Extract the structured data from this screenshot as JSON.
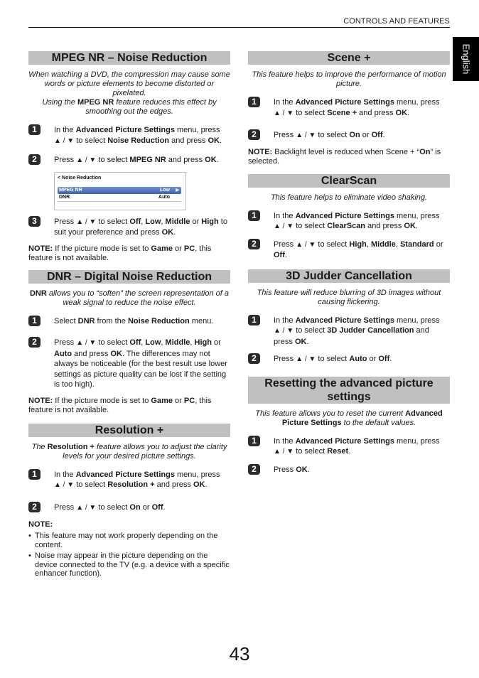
{
  "header": {
    "section": "CONTROLS AND FEATURES",
    "language_tab": "English"
  },
  "page_number": "43",
  "colors": {
    "section_bar": "#c0c0c0",
    "step_badge": "#2b2b2b",
    "menu_highlight": "#4a6db5",
    "language_tab": "#000000"
  },
  "sections": {
    "mpeg": {
      "title": "MPEG NR – Noise Reduction",
      "intro1": "When watching a DVD, the compression may cause some words or picture elements to become distorted or pixelated.",
      "intro2_a": "Using the ",
      "intro2_b": "MPEG NR",
      "intro2_c": " feature reduces this effect by smoothing out the edges.",
      "step1": {
        "num": "1",
        "a": "In the ",
        "b": "Advanced Picture Settings",
        "c": " menu, press ",
        "arrows": "▲ / ▼",
        "d": " to select ",
        "e": "Noise Reduction",
        "f": " and press ",
        "g": "OK",
        "h": "."
      },
      "step2": {
        "num": "2",
        "a": "Press ",
        "arrows": "▲ / ▼",
        "b": " to select ",
        "c": "MPEG NR",
        "d": " and press ",
        "e": "OK",
        "f": "."
      },
      "menu": {
        "title": "< Noise Reduction",
        "rows": [
          {
            "label": "MPEG NR",
            "value": "Low",
            "selected": true,
            "arrow": "▶"
          },
          {
            "label": "DNR",
            "value": "Auto",
            "selected": false
          }
        ]
      },
      "step3": {
        "num": "3",
        "a": "Press ",
        "arrows": "▲ / ▼",
        "b": " to select ",
        "c": "Off",
        "d": ", ",
        "e": "Low",
        "f": ", ",
        "g": "Middle",
        "h": " or ",
        "i": "High",
        "j": " to suit your preference and press ",
        "k": "OK",
        "l": "."
      },
      "note": {
        "label": "NOTE:",
        "a": " If the picture mode is set to ",
        "b": "Game",
        "c": " or ",
        "d": "PC",
        "e": ", this feature is not available."
      }
    },
    "dnr": {
      "title": "DNR – Digital Noise Reduction",
      "intro_a": "DNR",
      "intro_b": " allows you to “soften” the screen representation of a weak signal to reduce the noise effect.",
      "step1": {
        "num": "1",
        "a": "Select ",
        "b": "DNR",
        "c": " from the ",
        "d": "Noise Reduction",
        "e": " menu."
      },
      "step2": {
        "num": "2",
        "a": "Press ",
        "arrows": "▲ / ▼",
        "b": " to select ",
        "c": "Off",
        "d": ", ",
        "e": "Low",
        "f": ", ",
        "g": "Middle",
        "h": ", ",
        "i": "High",
        "j": " or ",
        "k": "Auto",
        "l": " and press ",
        "m": "OK",
        "n": ". The differences may not always be noticeable (for the best result use lower settings as picture quality can be lost if the setting is too high)."
      },
      "note": {
        "label": "NOTE:",
        "a": " If the picture mode is set to ",
        "b": "Game",
        "c": " or ",
        "d": "PC",
        "e": ", this feature is not available."
      }
    },
    "resolution": {
      "title": "Resolution +",
      "intro_a": "The ",
      "intro_b": "Resolution +",
      "intro_c": " feature allows you to adjust the clarity levels for your desired picture settings.",
      "step1": {
        "num": "1",
        "a": "In the ",
        "b": "Advanced Picture Settings",
        "c": " menu, press ",
        "arrows": "▲ / ▼",
        "d": " to select ",
        "e": "Resolution +",
        "f": " and press ",
        "g": "OK",
        "h": "."
      },
      "step2": {
        "num": "2",
        "a": "Press ",
        "arrows": "▲ / ▼",
        "b": " to select ",
        "c": "On",
        "d": " or ",
        "e": "Off",
        "f": "."
      },
      "note_label": "NOTE:",
      "bullets": [
        "This feature may not work properly depending on the content.",
        "Noise may appear in the picture depending on the device connected to the TV (e.g. a device with a specific enhancer function)."
      ]
    },
    "scene": {
      "title": "Scene +",
      "intro": "This feature helps to improve the performance of motion picture.",
      "step1": {
        "num": "1",
        "a": "In the ",
        "b": "Advanced Picture Settings",
        "c": " menu, press ",
        "arrows": "▲ / ▼",
        "d": " to select ",
        "e": "Scene +",
        "f": " and press ",
        "g": "OK",
        "h": "."
      },
      "step2": {
        "num": "2",
        "a": "Press ",
        "arrows": "▲ / ▼",
        "b": " to select ",
        "c": "On",
        "d": " or ",
        "e": "Off",
        "f": "."
      },
      "note": {
        "label": "NOTE:",
        "a": " Backlight level is reduced when Scene + “",
        "b": "On",
        "c": "” is selected."
      }
    },
    "clearscan": {
      "title": "ClearScan",
      "intro": "This feature helps to eliminate video shaking.",
      "step1": {
        "num": "1",
        "a": "In the ",
        "b": "Advanced Picture Settings",
        "c": " menu, press ",
        "arrows": "▲ / ▼",
        "d": " to select ",
        "e": "ClearScan",
        "f": " and press ",
        "g": "OK",
        "h": "."
      },
      "step2": {
        "num": "2",
        "a": "Press ",
        "arrows": "▲ / ▼",
        "b": " to select ",
        "c": "High",
        "d": ", ",
        "e": "Middle",
        "f": ", ",
        "g": "Standard",
        "h": " or ",
        "i": "Off",
        "j": "."
      }
    },
    "judder": {
      "title": "3D Judder Cancellation",
      "intro": "This feature will reduce blurring of 3D images without causing flickering.",
      "step1": {
        "num": "1",
        "a": "In the ",
        "b": "Advanced Picture Settings",
        "c": " menu, press ",
        "arrows": "▲ / ▼",
        "d": " to select ",
        "e": "3D Judder Cancellation",
        "f": " and press ",
        "g": "OK",
        "h": "."
      },
      "step2": {
        "num": "2",
        "a": "Press ",
        "arrows": "▲ / ▼",
        "b": " to select ",
        "c": "Auto",
        "d": " or ",
        "e": "Off",
        "f": "."
      }
    },
    "reset": {
      "title": "Resetting the advanced picture settings",
      "intro_a": "This feature allows you to reset the current ",
      "intro_b": "Advanced Picture Settings",
      "intro_c": " to the default values.",
      "step1": {
        "num": "1",
        "a": "In the ",
        "b": "Advanced Picture Settings",
        "c": " menu, press ",
        "arrows": "▲ / ▼",
        "d": " to select ",
        "e": "Reset",
        "f": "."
      },
      "step2": {
        "num": "2",
        "a": "Press ",
        "b": "OK",
        "c": "."
      }
    }
  }
}
